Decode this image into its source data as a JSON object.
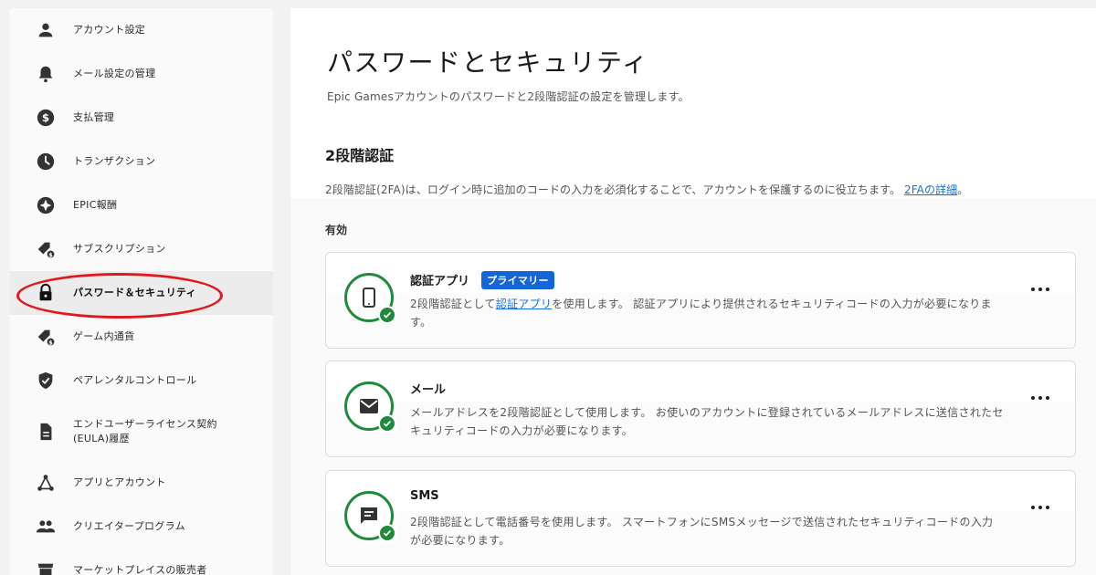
{
  "sidebar": {
    "items": [
      {
        "label": "アカウント設定",
        "icon": "person-icon"
      },
      {
        "label": "メール設定の管理",
        "icon": "bell-icon"
      },
      {
        "label": "支払管理",
        "icon": "dollar-icon"
      },
      {
        "label": "トランザクション",
        "icon": "clock-icon"
      },
      {
        "label": "EPIC報酬",
        "icon": "star-icon"
      },
      {
        "label": "サブスクリプション",
        "icon": "tag-icon"
      },
      {
        "label": "パスワード＆セキュリティ",
        "icon": "lock-icon",
        "active": true
      },
      {
        "label": "ゲーム内通貨",
        "icon": "tag-icon"
      },
      {
        "label": "ペアレンタルコントロール",
        "icon": "shield-icon"
      },
      {
        "label": "エンドユーザーライセンス契約\n(EULA)履歴",
        "icon": "document-icon"
      },
      {
        "label": "アプリとアカウント",
        "icon": "share-icon"
      },
      {
        "label": "クリエイタープログラム",
        "icon": "group-icon"
      },
      {
        "label": "マーケットプレイスの販売者",
        "icon": "store-icon"
      }
    ]
  },
  "main": {
    "title": "パスワードとセキュリティ",
    "subtitle": "Epic Gamesアカウントのパスワードと2段階認証の設定を管理します。",
    "twofa": {
      "heading": "2段階認証",
      "description": "2段階認証(2FA)は、ログイン時に追加のコードの入力を必須化することで、アカウントを保護するのに役立ちます。",
      "link_text": "2FAの詳細",
      "link_suffix": "。",
      "enabled_label": "有効"
    },
    "methods": [
      {
        "title": "認証アプリ",
        "badge": "プライマリー",
        "icon": "phone-icon",
        "desc_before": "2段階認証として",
        "desc_link": "認証アプリ",
        "desc_after": "を使用します。 認証アプリにより提供されるセキュリティコードの入力が必要になります。"
      },
      {
        "title": "メール",
        "icon": "mail-icon",
        "description": "メールアドレスを2段階認証として使用します。 お使いのアカウントに登録されているメールアドレスに送信されたセキュリティコードの入力が必要になります。"
      },
      {
        "title": "SMS",
        "icon": "message-icon",
        "description": "2段階認証として電話番号を使用します。 スマートフォンにSMSメッセージで送信されたセキュリティコードの入力が必要になります。"
      }
    ]
  },
  "colors": {
    "accent_green": "#1f8a3c",
    "primary_blue": "#1466d8",
    "link_blue": "#1d6fd8",
    "highlight_red": "#e1191f"
  }
}
